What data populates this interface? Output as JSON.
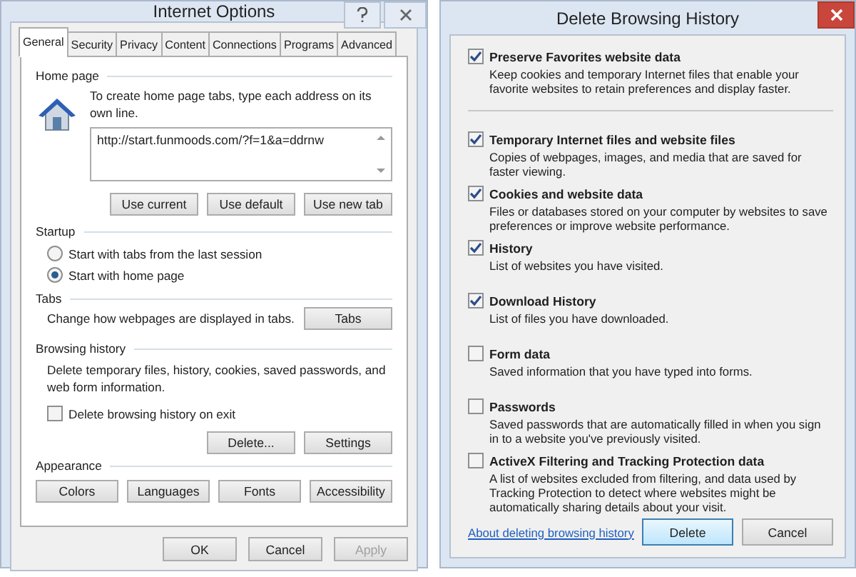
{
  "internet_options": {
    "title": "Internet Options",
    "tabs": [
      {
        "label": "General",
        "selected": true
      },
      {
        "label": "Security",
        "selected": false
      },
      {
        "label": "Privacy",
        "selected": false
      },
      {
        "label": "Content",
        "selected": false
      },
      {
        "label": "Connections",
        "selected": false
      },
      {
        "label": "Programs",
        "selected": false
      },
      {
        "label": "Advanced",
        "selected": false
      }
    ],
    "home_page": {
      "heading": "Home page",
      "hint": "To create home page tabs, type each address on its own line.",
      "url": "http://start.funmoods.com/?f=1&a=ddrnw",
      "buttons": [
        "Use current",
        "Use default",
        "Use new tab"
      ]
    },
    "startup": {
      "heading": "Startup",
      "options": [
        {
          "label": "Start with tabs from the last session",
          "selected": false
        },
        {
          "label": "Start with home page",
          "selected": true
        }
      ]
    },
    "tabs_section": {
      "heading": "Tabs",
      "text": "Change how webpages are displayed in tabs.",
      "button": "Tabs"
    },
    "browsing_history": {
      "heading": "Browsing history",
      "text": "Delete temporary files, history, cookies, saved passwords, and web form information.",
      "checkbox": {
        "label": "Delete browsing history on exit",
        "checked": false
      },
      "buttons": [
        "Delete...",
        "Settings"
      ]
    },
    "appearance": {
      "heading": "Appearance",
      "buttons": [
        "Colors",
        "Languages",
        "Fonts",
        "Accessibility"
      ]
    },
    "footer_buttons": [
      {
        "label": "OK",
        "disabled": false
      },
      {
        "label": "Cancel",
        "disabled": false
      },
      {
        "label": "Apply",
        "disabled": true
      }
    ]
  },
  "delete_browsing_history": {
    "title": "Delete Browsing History",
    "preserve": {
      "title": "Preserve Favorites website data",
      "description": "Keep cookies and temporary Internet files that enable your favorite websites to retain preferences and display faster.",
      "checked": true
    },
    "items": [
      {
        "title": "Temporary Internet files and website files",
        "description": "Copies of webpages, images, and media that are saved for faster viewing.",
        "checked": true
      },
      {
        "title": "Cookies and website data",
        "description": "Files or databases stored on your computer by websites to save preferences or improve website performance.",
        "checked": true
      },
      {
        "title": "History",
        "description": "List of websites you have visited.",
        "checked": true
      },
      {
        "title": "Download History",
        "description": "List of files you have downloaded.",
        "checked": true
      },
      {
        "title": "Form data",
        "description": "Saved information that you have typed into forms.",
        "checked": false
      },
      {
        "title": "Passwords",
        "description": "Saved passwords that are automatically filled in when you sign in to a website you've previously visited.",
        "checked": false
      },
      {
        "title": "ActiveX Filtering and Tracking Protection data",
        "description": "A list of websites excluded from filtering, and data used by Tracking Protection to detect where websites might be automatically sharing details about your visit.",
        "checked": false
      }
    ],
    "link": "About deleting browsing history",
    "buttons": [
      {
        "label": "Delete",
        "default": true
      },
      {
        "label": "Cancel",
        "default": false
      }
    ]
  }
}
